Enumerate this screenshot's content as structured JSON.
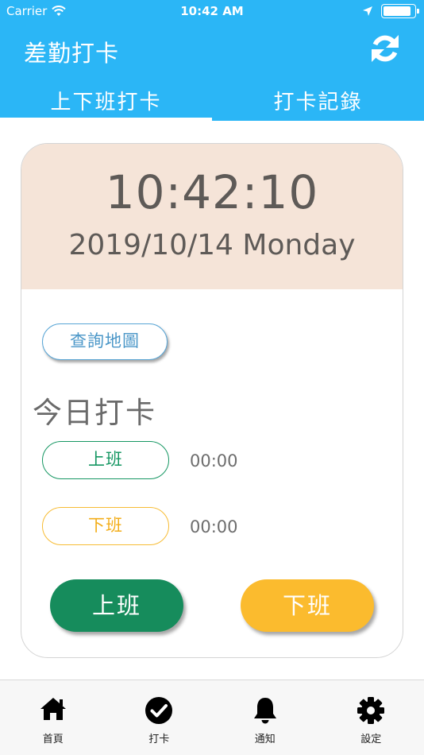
{
  "status_bar": {
    "carrier": "Carrier",
    "time": "10:42 AM"
  },
  "nav": {
    "title": "差勤打卡"
  },
  "tabs": [
    {
      "label": "上下班打卡",
      "active": true
    },
    {
      "label": "打卡記錄",
      "active": false
    }
  ],
  "clock": {
    "time": "10:42:10",
    "date": "2019/10/14 Monday"
  },
  "map_button": "查詢地圖",
  "today_label": "今日打卡",
  "records": {
    "clock_in_label": "上班",
    "clock_in_time": "00:00",
    "clock_out_label": "下班",
    "clock_out_time": "00:00"
  },
  "actions": {
    "clock_in": "上班",
    "clock_out": "下班"
  },
  "tabbar": [
    {
      "label": "首頁",
      "icon": "home-icon"
    },
    {
      "label": "打卡",
      "icon": "check-circle-icon"
    },
    {
      "label": "通知",
      "icon": "bell-icon"
    },
    {
      "label": "設定",
      "icon": "gear-icon"
    }
  ],
  "colors": {
    "header": "#2bb6f6",
    "clock_bg": "#f5e4d8",
    "green": "#168c5c",
    "yellow": "#fbbb2e",
    "map_blue": "#4b97c8"
  }
}
